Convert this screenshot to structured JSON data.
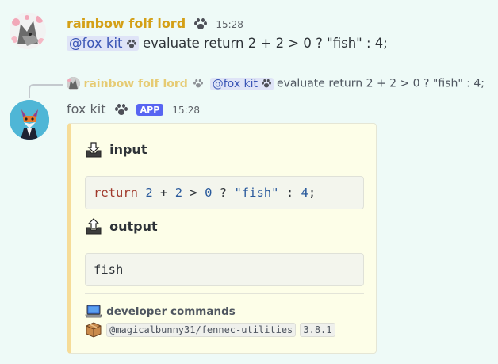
{
  "message1": {
    "username": "rainbow folf lord",
    "timestamp": "15:28",
    "mention": "@fox kit",
    "text": "evaluate return 2 + 2 > 0 ? \"fish\" : 4;"
  },
  "reply": {
    "username": "rainbow folf lord",
    "mention": "@fox kit",
    "text": "evaluate return 2 + 2 > 0 ? \"fish\" : 4;"
  },
  "message2": {
    "username": "fox kit",
    "badge": "APP",
    "timestamp": "15:28"
  },
  "embed": {
    "input_title": "input",
    "code_tokens": {
      "kw": "return",
      "n1": "2",
      "plus": "+",
      "n2": "2",
      "gt": ">",
      "n3": "0",
      "q": "?",
      "str": "\"fish\"",
      "colon": ":",
      "n4": "4",
      "semi": ";"
    },
    "output_title": "output",
    "output_value": "fish",
    "footer_title": "developer commands",
    "package": "@magicalbunny31/fennec-utilities",
    "version": "3.8.1"
  },
  "colors": {
    "username": "#d4a017",
    "accent_bar": "#f6dc98",
    "embed_bg": "#fdfee8",
    "app_badge": "#5865f2"
  }
}
